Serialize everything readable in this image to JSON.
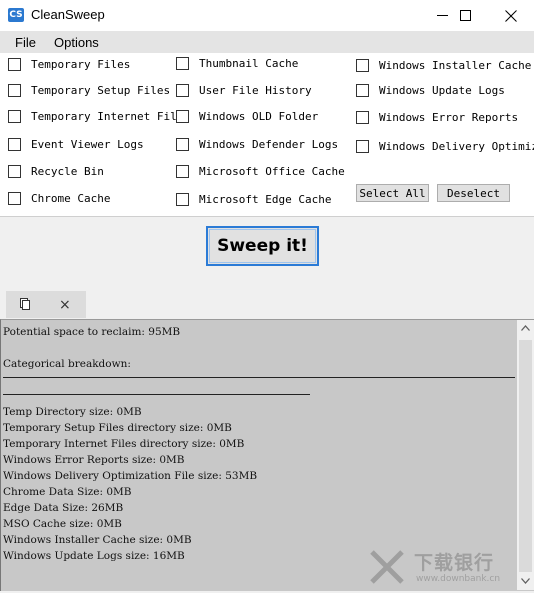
{
  "window": {
    "title": "CleanSweep",
    "app_icon_text": "CS",
    "controls": [
      "minimize-icon",
      "maximize-icon",
      "close-icon"
    ]
  },
  "menu": [
    "File",
    "Options"
  ],
  "checkboxes": {
    "col1": [
      "Temporary Files",
      "Temporary Setup Files",
      "Temporary Internet Files",
      "Event Viewer Logs",
      "Recycle Bin",
      "Chrome Cache"
    ],
    "col2": [
      "Thumbnail Cache",
      "User File History",
      "Windows OLD Folder",
      "Windows Defender Logs",
      "Microsoft Office Cache",
      "Microsoft Edge Cache"
    ],
    "col3": [
      "Windows Installer Cache",
      "Windows Update Logs",
      "Windows Error Reports",
      "Windows Delivery Optimizat"
    ]
  },
  "buttons": {
    "select_all": "Select All",
    "deselect": "Deselect",
    "sweep": "Sweep it!"
  },
  "tab": {
    "icon": "document-icon",
    "close": "×"
  },
  "output": {
    "lines": [
      "Potential space to reclaim: 95MB",
      "",
      "Categorical breakdown:",
      "",
      "",
      "Temp Directory size: 0MB",
      "Temporary Setup Files directory size: 0MB",
      "Temporary Internet Files directory size: 0MB",
      "Windows Error Reports size: 0MB",
      "Windows Delivery Optimization File size: 53MB",
      "Chrome Data Size: 0MB",
      "Edge Data Size: 26MB",
      "MSO Cache size: 0MB",
      "Windows Installer Cache size: 0MB",
      "Windows Update Logs size: 16MB"
    ]
  },
  "watermark": {
    "text": "下载银行",
    "url": "www.downbank.cn"
  }
}
